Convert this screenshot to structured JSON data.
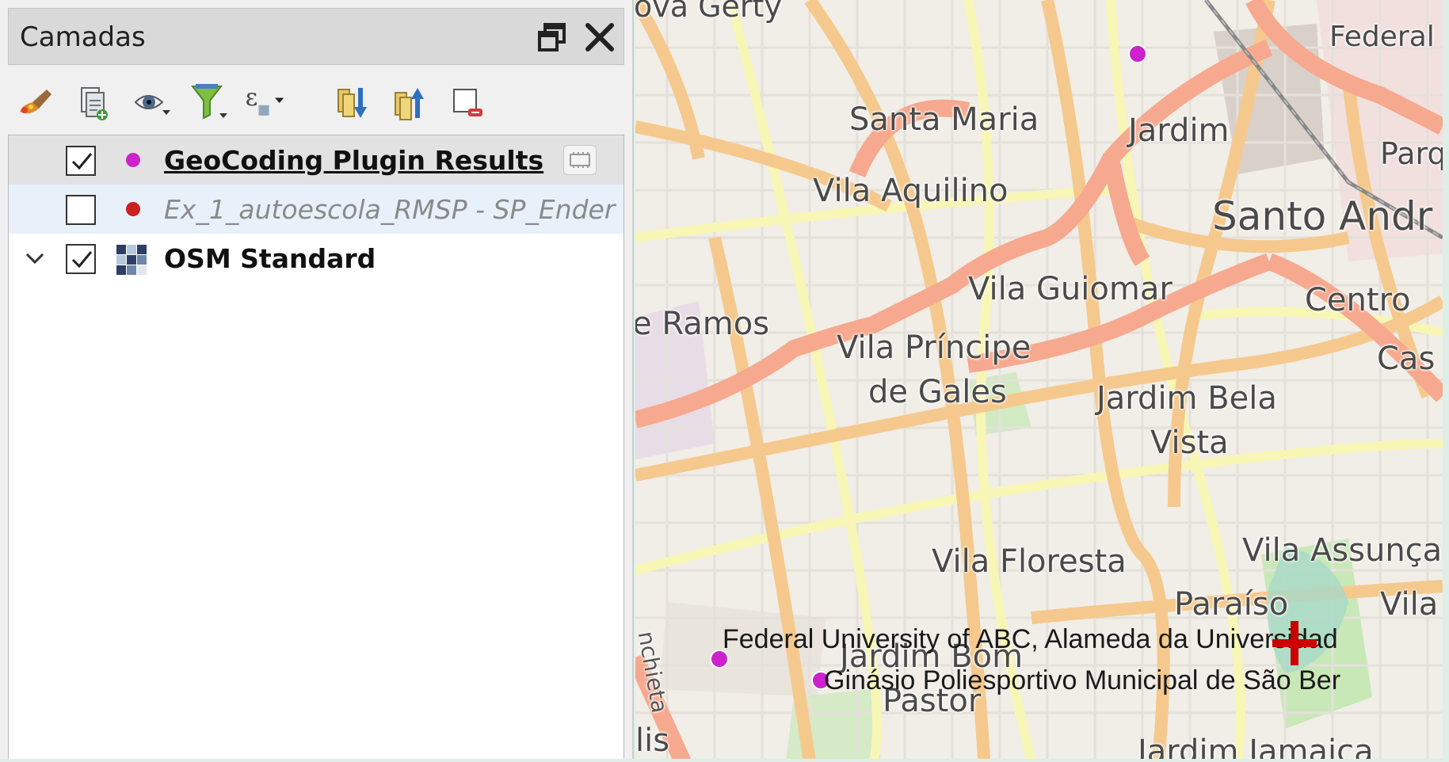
{
  "panel": {
    "title": "Camadas",
    "title_buttons": [
      "float-icon",
      "close-icon"
    ],
    "toolbar": [
      {
        "name": "style-manager-icon"
      },
      {
        "name": "add-group-icon"
      },
      {
        "name": "manage-visibility-icon"
      },
      {
        "name": "filter-legend-icon"
      },
      {
        "name": "filter-expression-icon"
      },
      {
        "name": "expand-all-icon"
      },
      {
        "name": "collapse-all-icon"
      },
      {
        "name": "remove-layer-icon"
      }
    ],
    "layers": [
      {
        "label": "GeoCoding Plugin Results",
        "checked": true,
        "color": "#cc22cc"
      },
      {
        "label": "Ex_1_autoescola_RMSP - SP_Ender",
        "checked": false,
        "color": "#cc1f1f"
      },
      {
        "label": "OSM Standard",
        "checked": true
      }
    ]
  },
  "map": {
    "place_labels": [
      {
        "text": "ova Gerty"
      },
      {
        "text": "Federal"
      },
      {
        "text": "Santa Maria"
      },
      {
        "text": "Jardim"
      },
      {
        "text": "Parq"
      },
      {
        "text": "Vila Aquilino"
      },
      {
        "text": "Santo Andr"
      },
      {
        "text": "Vila Guiomar"
      },
      {
        "text": "Centro"
      },
      {
        "text": "e Ramos"
      },
      {
        "text": "Vila Príncipe"
      },
      {
        "text": "de Gales"
      },
      {
        "text": "Jardim Bela"
      },
      {
        "text": "Vista"
      },
      {
        "text": "Cas"
      },
      {
        "text": "Vila Floresta"
      },
      {
        "text": "Vila Assunça"
      },
      {
        "text": "Paraíso"
      },
      {
        "text": "Vila"
      },
      {
        "text": "Jardim Bom"
      },
      {
        "text": "Pastor"
      },
      {
        "text": "Jardim Jamaica"
      },
      {
        "text": "lis"
      },
      {
        "text": "nchieta"
      }
    ],
    "geocode_labels": [
      {
        "text": "Federal University of ABC, Alameda da Universidad"
      },
      {
        "text": "Ginásio Poliesportivo Municipal de São Ber"
      }
    ],
    "colors": {
      "background": "#f1ede7",
      "primary_road": "#f6a98f",
      "secondary_road": "#f5c98d",
      "tertiary_road": "#f8f6b5",
      "park": "#c9e8b8",
      "geocode_point": "#cc22cc",
      "crosshair": "#cc0000"
    }
  }
}
